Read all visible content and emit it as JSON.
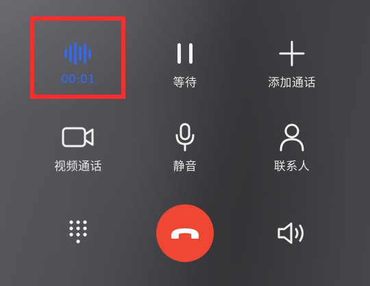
{
  "controls": {
    "record": {
      "label": "00:01",
      "icon": "voice-wave-icon"
    },
    "hold": {
      "label": "等待",
      "icon": "pause-icon"
    },
    "add_call": {
      "label": "添加通话",
      "icon": "plus-icon"
    },
    "video_call": {
      "label": "视频通话",
      "icon": "video-camera-icon"
    },
    "mute": {
      "label": "静音",
      "icon": "microphone-icon"
    },
    "contacts": {
      "label": "联系人",
      "icon": "person-icon"
    }
  },
  "bottom": {
    "dialpad": {
      "icon": "dialpad-icon"
    },
    "hangup": {
      "icon": "phone-hangup-icon",
      "color": "#ef4732"
    },
    "speaker": {
      "icon": "speaker-icon"
    }
  },
  "colors": {
    "accent_blue": "#2f6bff",
    "highlight_red": "#ff2b2b",
    "label_white": "#e6e6e6"
  }
}
